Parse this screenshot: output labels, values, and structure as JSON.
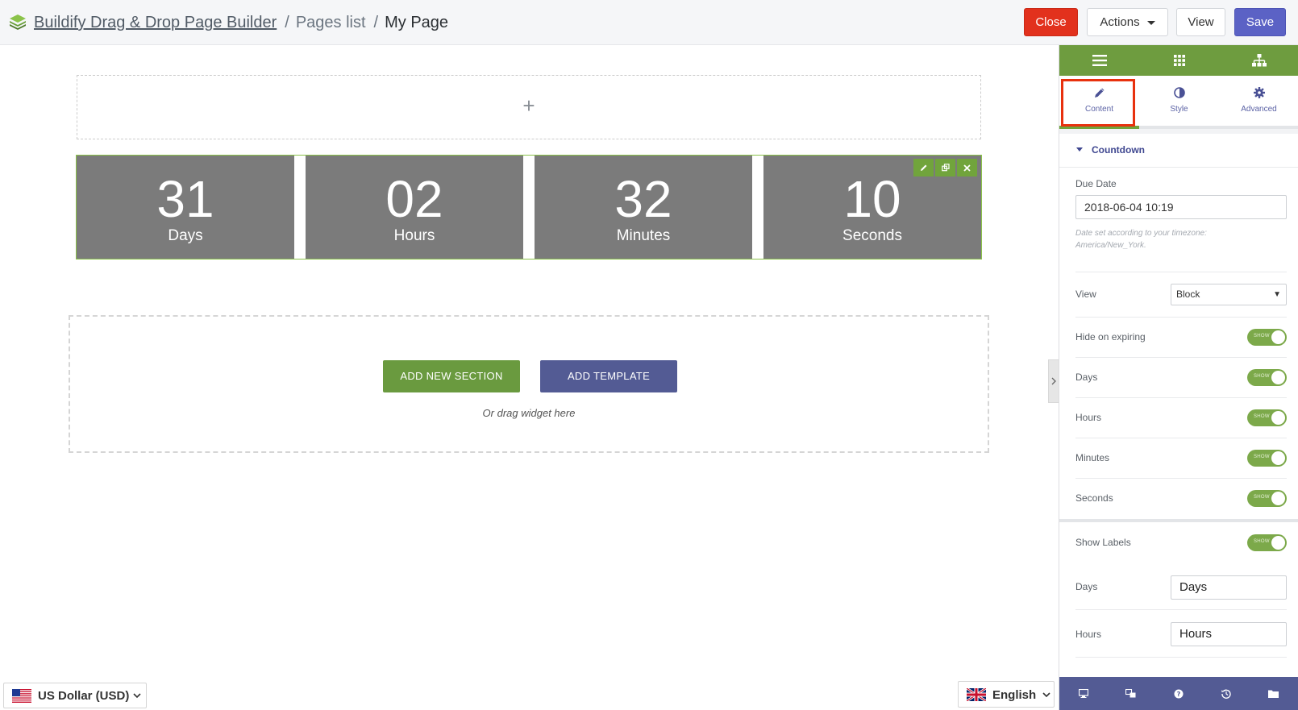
{
  "header": {
    "breadcrumb": [
      "Buildify Drag & Drop Page Builder",
      "Pages list",
      "My Page"
    ],
    "separator": "/",
    "buttons": {
      "close": "Close",
      "actions": "Actions",
      "view": "View",
      "save": "Save"
    }
  },
  "canvas": {
    "empty_section_icon": "+",
    "countdown": [
      {
        "value": "31",
        "label": "Days"
      },
      {
        "value": "02",
        "label": "Hours"
      },
      {
        "value": "32",
        "label": "Minutes"
      },
      {
        "value": "10",
        "label": "Seconds"
      }
    ],
    "add_new_section": "ADD NEW SECTION",
    "add_template": "ADD TEMPLATE",
    "drag_hint": "Or drag widget here"
  },
  "panel": {
    "tabs": [
      {
        "label": "Content",
        "icon": "pencil-icon"
      },
      {
        "label": "Style",
        "icon": "contrast-icon"
      },
      {
        "label": "Advanced",
        "icon": "gear-icon"
      }
    ],
    "section_title": "Countdown",
    "due_date": {
      "label": "Due Date",
      "value": "2018-06-04 10:19",
      "note": "Date set according to your timezone: America/New_York."
    },
    "view": {
      "label": "View",
      "value": "Block"
    },
    "toggles": [
      {
        "label": "Hide on expiring",
        "state": "SHOW"
      },
      {
        "label": "Days",
        "state": "SHOW"
      },
      {
        "label": "Hours",
        "state": "SHOW"
      },
      {
        "label": "Minutes",
        "state": "SHOW"
      },
      {
        "label": "Seconds",
        "state": "SHOW"
      }
    ],
    "show_labels": {
      "label": "Show Labels",
      "state": "SHOW"
    },
    "label_inputs": [
      {
        "label": "Days",
        "value": "Days"
      },
      {
        "label": "Hours",
        "value": "Hours"
      }
    ]
  },
  "footer": {
    "currency": "US Dollar (USD)",
    "language": "English"
  },
  "colors": {
    "accent_green": "#6e9c3f",
    "accent_purple": "#535b94",
    "close_red": "#e2311d",
    "save_blue": "#5b62c5",
    "countdown_bg": "#7b7b7b"
  }
}
